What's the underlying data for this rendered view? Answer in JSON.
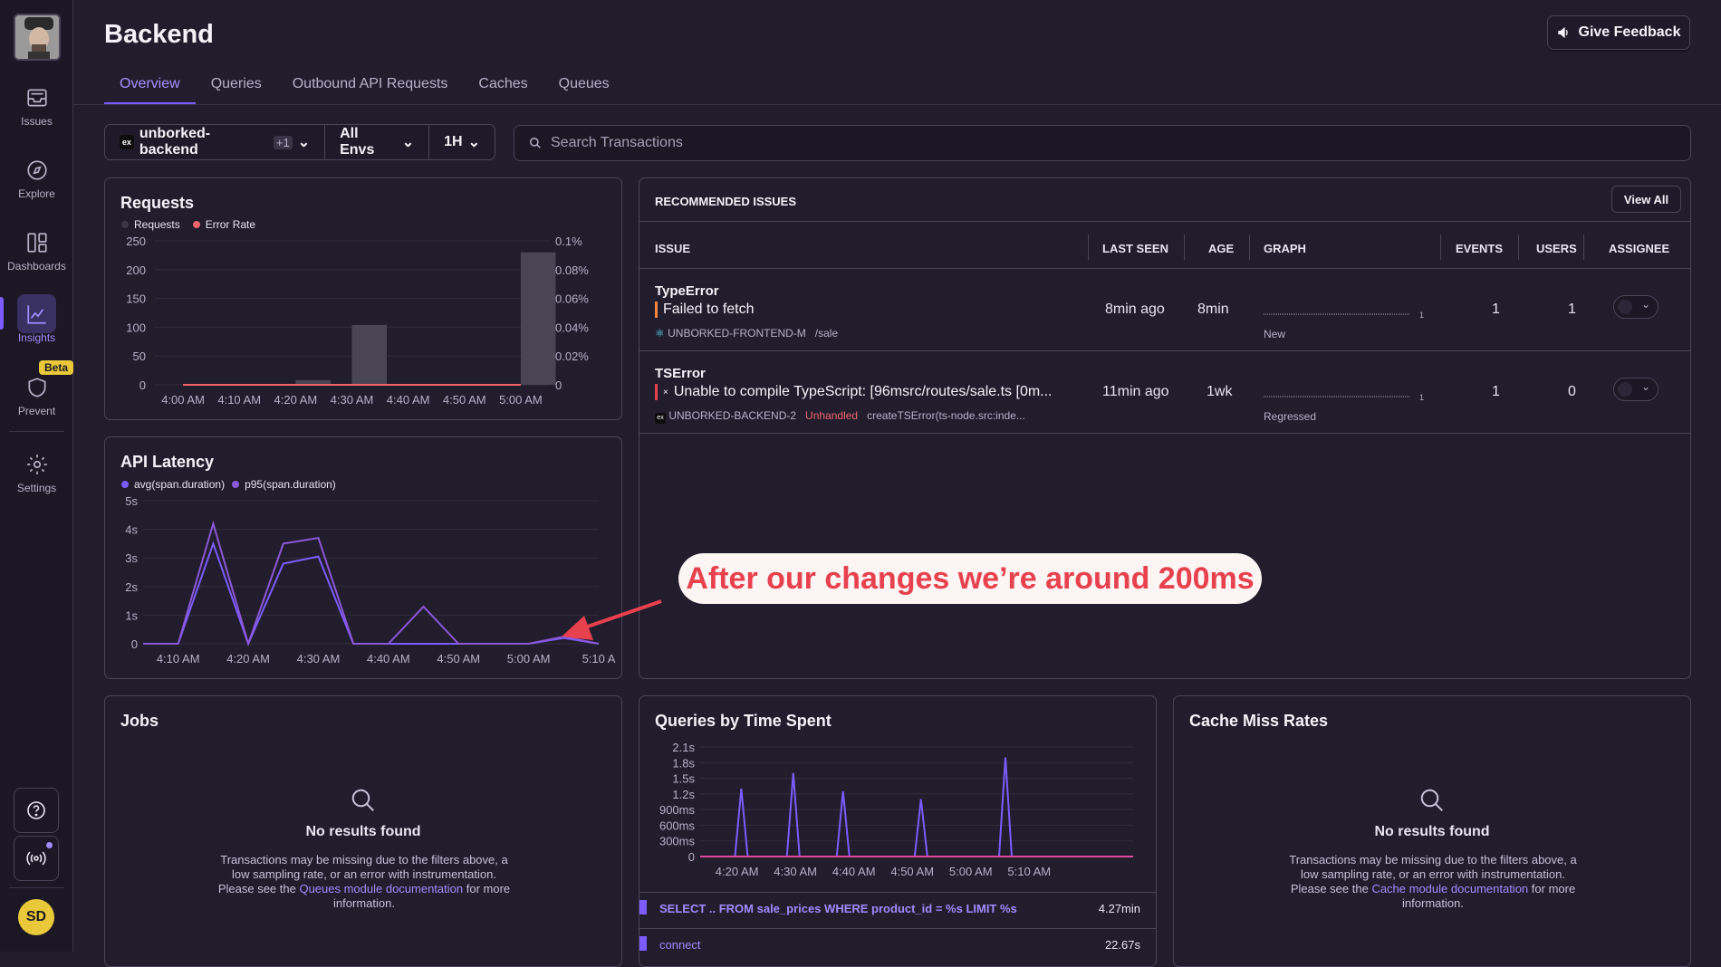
{
  "nav": {
    "items": [
      {
        "label": "Issues",
        "icon": "inbox-icon"
      },
      {
        "label": "Explore",
        "icon": "compass-icon"
      },
      {
        "label": "Dashboards",
        "icon": "dashboard-icon"
      },
      {
        "label": "Insights",
        "icon": "graph-icon"
      },
      {
        "label": "Prevent",
        "icon": "shield-icon"
      },
      {
        "label": "Settings",
        "icon": "gear-icon"
      }
    ],
    "beta": "Beta",
    "user_initials": "SD"
  },
  "header": {
    "title": "Backend",
    "feedback": "Give Feedback",
    "tabs": [
      "Overview",
      "Queries",
      "Outbound API Requests",
      "Caches",
      "Queues"
    ]
  },
  "filters": {
    "project": "unborked-backend",
    "project_extra": "+1",
    "env": "All Envs",
    "period": "1H",
    "search_placeholder": "Search Transactions"
  },
  "requests": {
    "title": "Requests",
    "legend": [
      "Requests",
      "Error Rate"
    ],
    "chart_data": {
      "type": "bar",
      "categories": [
        "4:00 AM",
        "4:10 AM",
        "4:20 AM",
        "4:30 AM",
        "4:40 AM",
        "4:50 AM",
        "5:00 AM"
      ],
      "series": [
        {
          "name": "Requests",
          "values": [
            0,
            0,
            8,
            104,
            0,
            0,
            230
          ]
        },
        {
          "name": "Error Rate",
          "values": [
            0,
            0,
            0,
            0,
            0,
            0,
            0
          ]
        }
      ],
      "y_ticks": [
        "250",
        "200",
        "150",
        "100",
        "50",
        "0"
      ],
      "y2_ticks": [
        "0.1%",
        "0.08%",
        "0.06%",
        "0.04%",
        "0.02%",
        "0"
      ],
      "ylim": [
        0,
        250
      ],
      "y2lim": [
        0,
        0.1
      ]
    }
  },
  "latency": {
    "title": "API Latency",
    "legend": [
      "avg(span.duration)",
      "p95(span.duration)"
    ],
    "chart_data": {
      "type": "line",
      "x": [
        "4:05",
        "4:10",
        "4:15",
        "4:20",
        "4:25",
        "4:30",
        "4:35",
        "4:40",
        "4:45",
        "4:50",
        "4:55",
        "5:00",
        "5:05",
        "5:10"
      ],
      "x_ticks": [
        "4:10 AM",
        "4:20 AM",
        "4:30 AM",
        "4:40 AM",
        "4:50 AM",
        "5:00 AM",
        "5:10 A"
      ],
      "y_ticks": [
        "5s",
        "4s",
        "3s",
        "2s",
        "1s",
        "0"
      ],
      "ylim": [
        0,
        5
      ],
      "series": [
        {
          "name": "avg(span.duration)",
          "values": [
            0,
            0,
            3.5,
            0,
            2.8,
            3.05,
            0,
            0,
            0,
            0,
            0,
            0,
            0.2,
            0
          ]
        },
        {
          "name": "p95(span.duration)",
          "values": [
            0,
            0,
            4.2,
            0,
            3.5,
            3.7,
            0,
            0,
            1.3,
            0,
            0,
            0,
            0.25,
            0
          ]
        }
      ]
    }
  },
  "issues": {
    "header": "RECOMMENDED ISSUES",
    "view_all": "View All",
    "columns": [
      "ISSUE",
      "LAST SEEN",
      "AGE",
      "GRAPH",
      "EVENTS",
      "USERS",
      "ASSIGNEE"
    ],
    "rows": [
      {
        "type": "TypeError",
        "message": "Failed to fetch",
        "project": "UNBORKED-FRONTEND-M",
        "culprit": "/sale",
        "handled": "",
        "last_seen": "8min ago",
        "age": "8min",
        "graph_label": "New",
        "graph_max": "1",
        "events": "1",
        "users": "1",
        "level_color": "#f5843d"
      },
      {
        "type": "TSError",
        "message": "Unable to compile TypeScript:  [96msrc/routes/sale.ts [0m...",
        "project": "UNBORKED-BACKEND-2",
        "culprit": "createTSError(ts-node.src:inde...",
        "handled": "Unhandled",
        "last_seen": "11min ago",
        "age": "1wk",
        "graph_label": "Regressed",
        "graph_max": "1",
        "events": "1",
        "users": "0",
        "level_color": "#e8414e"
      }
    ]
  },
  "jobs": {
    "title": "Jobs",
    "no_results": "No results found",
    "desc_pre": "Transactions may be missing due to the filters above, a low sampling rate, or an error with instrumentation. Please see the ",
    "link": "Queues module documentation",
    "desc_post": " for more information."
  },
  "queries": {
    "title": "Queries by Time Spent",
    "chart_data": {
      "type": "line",
      "y_ticks": [
        "2.1s",
        "1.8s",
        "1.5s",
        "1.2s",
        "900ms",
        "600ms",
        "300ms",
        "0"
      ],
      "x_ticks": [
        "4:20 AM",
        "4:30 AM",
        "4:40 AM",
        "4:50 AM",
        "5:00 AM",
        "5:10 AM"
      ],
      "ylim": [
        0,
        2.1
      ],
      "spikes": [
        1.3,
        1.6,
        1.25,
        1.1,
        1.9
      ]
    },
    "rows": [
      {
        "query": "SELECT .. FROM sale_prices WHERE product_id = %s LIMIT %s",
        "time": "4.27min"
      },
      {
        "query": "connect",
        "time": "22.67s"
      }
    ]
  },
  "cache": {
    "title": "Cache Miss Rates",
    "no_results": "No results found",
    "desc_pre": "Transactions may be missing due to the filters above, a low sampling rate, or an error with instrumentation. Please see the ",
    "link": "Cache module documentation",
    "desc_post": " for more information."
  },
  "annotation": "After our changes we’re around 200ms",
  "colors": {
    "accent": "#7c5cff",
    "error": "#f0646c",
    "annotation": "#e8414e"
  }
}
